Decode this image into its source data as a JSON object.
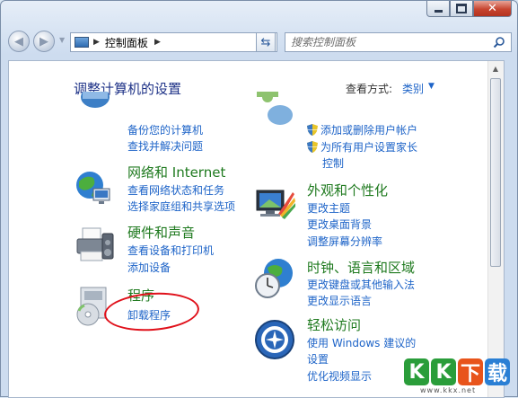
{
  "window": {
    "caption": {
      "minimize_icon": "minimize-icon",
      "maximize_icon": "maximize-icon",
      "close_icon": "close-icon",
      "close_glyph": "✕"
    }
  },
  "nav": {
    "back_icon": "back-arrow-icon",
    "forward_icon": "forward-arrow-icon",
    "recent_pages_icon": "chevron-down-icon",
    "address": {
      "icon": "control-panel-icon",
      "segments": [
        "控制面板"
      ],
      "separator": "▶",
      "dropdown_icon": "chevron-down-icon"
    },
    "refresh_icon": "refresh-icon",
    "search": {
      "placeholder": "搜索控制面板",
      "value": "",
      "icon": "search-icon"
    }
  },
  "main": {
    "title": "调整计算机的设置",
    "view_by": {
      "label": "查看方式:",
      "value": "类别",
      "dropdown_icon": "chevron-down-icon"
    },
    "left_column": [
      {
        "title": "",
        "icon": "system-security-icon",
        "links": [
          "备份您的计算机",
          "查找并解决问题"
        ]
      },
      {
        "title": "网络和 Internet",
        "icon": "network-globe-icon",
        "links": [
          "查看网络状态和任务",
          "选择家庭组和共享选项"
        ]
      },
      {
        "title": "硬件和声音",
        "icon": "printer-icon",
        "links": [
          "查看设备和打印机",
          "添加设备"
        ]
      },
      {
        "title": "程序",
        "icon": "programs-disc-icon",
        "links": [
          "卸载程序"
        ]
      }
    ],
    "right_column": [
      {
        "title": "",
        "icon": "user-accounts-icon",
        "links": [
          "添加或删除用户帐户",
          "为所有用户设置家长",
          "控制"
        ]
      },
      {
        "title": "外观和个性化",
        "icon": "appearance-monitor-icon",
        "links": [
          "更改主题",
          "更改桌面背景",
          "调整屏幕分辨率"
        ]
      },
      {
        "title": "时钟、语言和区域",
        "icon": "clock-globe-icon",
        "links": [
          "更改键盘或其他输入法",
          "更改显示语言"
        ]
      },
      {
        "title": "轻松访问",
        "icon": "ease-of-access-icon",
        "links": [
          "使用 Windows 建议的",
          "设置",
          "优化视频显示"
        ]
      }
    ]
  },
  "scrollbar": {
    "up_icon": "scroll-up-arrow-icon"
  },
  "watermark": {
    "letters": [
      "K",
      "K",
      "下",
      "载"
    ],
    "url": "www.kkx.net",
    "colors": [
      "#2a9d3a",
      "#2a9d3a",
      "#e8541b",
      "#2a7fd4"
    ]
  },
  "colors": {
    "link": "#1e64c8",
    "section_title": "#1f7a1f",
    "page_title": "#1e3287",
    "annotation": "#e0101a"
  }
}
